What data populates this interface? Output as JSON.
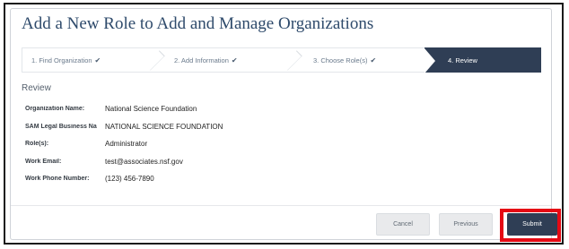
{
  "dialog": {
    "title": "Add a New Role to Add and Manage Organizations"
  },
  "steps": [
    {
      "label": "1. Find Organization",
      "check": "✔",
      "state": "complete"
    },
    {
      "label": "2. Add Information",
      "check": "✔",
      "state": "complete"
    },
    {
      "label": "3. Choose Role(s)",
      "check": "✔",
      "state": "complete"
    },
    {
      "label": "4. Review",
      "check": "",
      "state": "active"
    }
  ],
  "review": {
    "heading": "Review",
    "fields": [
      {
        "label": "Organization Name:",
        "value": "National Science Foundation"
      },
      {
        "label": "SAM Legal Business Na",
        "value": "NATIONAL SCIENCE FOUNDATION"
      },
      {
        "label": "Role(s):",
        "value": "Administrator"
      },
      {
        "label": "Work Email:",
        "value": "test@associates.nsf.gov"
      },
      {
        "label": "Work Phone Number:",
        "value": "(123) 456-7890"
      }
    ]
  },
  "buttons": {
    "cancel": "Cancel",
    "previous": "Previous",
    "submit": "Submit"
  },
  "colors": {
    "accent": "#2f3e55",
    "title": "#2e4a6b",
    "highlight": "#e50914"
  }
}
